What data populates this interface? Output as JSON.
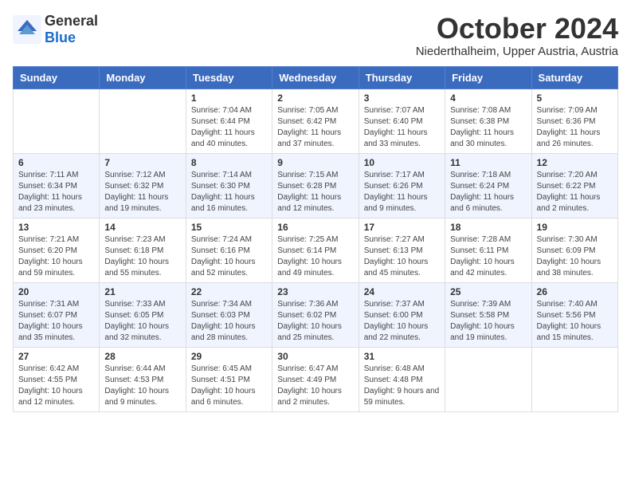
{
  "header": {
    "logo_general": "General",
    "logo_blue": "Blue",
    "month_title": "October 2024",
    "location": "Niederthalheim, Upper Austria, Austria"
  },
  "weekdays": [
    "Sunday",
    "Monday",
    "Tuesday",
    "Wednesday",
    "Thursday",
    "Friday",
    "Saturday"
  ],
  "weeks": [
    [
      {
        "day": "",
        "info": ""
      },
      {
        "day": "",
        "info": ""
      },
      {
        "day": "1",
        "info": "Sunrise: 7:04 AM\nSunset: 6:44 PM\nDaylight: 11 hours and 40 minutes."
      },
      {
        "day": "2",
        "info": "Sunrise: 7:05 AM\nSunset: 6:42 PM\nDaylight: 11 hours and 37 minutes."
      },
      {
        "day": "3",
        "info": "Sunrise: 7:07 AM\nSunset: 6:40 PM\nDaylight: 11 hours and 33 minutes."
      },
      {
        "day": "4",
        "info": "Sunrise: 7:08 AM\nSunset: 6:38 PM\nDaylight: 11 hours and 30 minutes."
      },
      {
        "day": "5",
        "info": "Sunrise: 7:09 AM\nSunset: 6:36 PM\nDaylight: 11 hours and 26 minutes."
      }
    ],
    [
      {
        "day": "6",
        "info": "Sunrise: 7:11 AM\nSunset: 6:34 PM\nDaylight: 11 hours and 23 minutes."
      },
      {
        "day": "7",
        "info": "Sunrise: 7:12 AM\nSunset: 6:32 PM\nDaylight: 11 hours and 19 minutes."
      },
      {
        "day": "8",
        "info": "Sunrise: 7:14 AM\nSunset: 6:30 PM\nDaylight: 11 hours and 16 minutes."
      },
      {
        "day": "9",
        "info": "Sunrise: 7:15 AM\nSunset: 6:28 PM\nDaylight: 11 hours and 12 minutes."
      },
      {
        "day": "10",
        "info": "Sunrise: 7:17 AM\nSunset: 6:26 PM\nDaylight: 11 hours and 9 minutes."
      },
      {
        "day": "11",
        "info": "Sunrise: 7:18 AM\nSunset: 6:24 PM\nDaylight: 11 hours and 6 minutes."
      },
      {
        "day": "12",
        "info": "Sunrise: 7:20 AM\nSunset: 6:22 PM\nDaylight: 11 hours and 2 minutes."
      }
    ],
    [
      {
        "day": "13",
        "info": "Sunrise: 7:21 AM\nSunset: 6:20 PM\nDaylight: 10 hours and 59 minutes."
      },
      {
        "day": "14",
        "info": "Sunrise: 7:23 AM\nSunset: 6:18 PM\nDaylight: 10 hours and 55 minutes."
      },
      {
        "day": "15",
        "info": "Sunrise: 7:24 AM\nSunset: 6:16 PM\nDaylight: 10 hours and 52 minutes."
      },
      {
        "day": "16",
        "info": "Sunrise: 7:25 AM\nSunset: 6:14 PM\nDaylight: 10 hours and 49 minutes."
      },
      {
        "day": "17",
        "info": "Sunrise: 7:27 AM\nSunset: 6:13 PM\nDaylight: 10 hours and 45 minutes."
      },
      {
        "day": "18",
        "info": "Sunrise: 7:28 AM\nSunset: 6:11 PM\nDaylight: 10 hours and 42 minutes."
      },
      {
        "day": "19",
        "info": "Sunrise: 7:30 AM\nSunset: 6:09 PM\nDaylight: 10 hours and 38 minutes."
      }
    ],
    [
      {
        "day": "20",
        "info": "Sunrise: 7:31 AM\nSunset: 6:07 PM\nDaylight: 10 hours and 35 minutes."
      },
      {
        "day": "21",
        "info": "Sunrise: 7:33 AM\nSunset: 6:05 PM\nDaylight: 10 hours and 32 minutes."
      },
      {
        "day": "22",
        "info": "Sunrise: 7:34 AM\nSunset: 6:03 PM\nDaylight: 10 hours and 28 minutes."
      },
      {
        "day": "23",
        "info": "Sunrise: 7:36 AM\nSunset: 6:02 PM\nDaylight: 10 hours and 25 minutes."
      },
      {
        "day": "24",
        "info": "Sunrise: 7:37 AM\nSunset: 6:00 PM\nDaylight: 10 hours and 22 minutes."
      },
      {
        "day": "25",
        "info": "Sunrise: 7:39 AM\nSunset: 5:58 PM\nDaylight: 10 hours and 19 minutes."
      },
      {
        "day": "26",
        "info": "Sunrise: 7:40 AM\nSunset: 5:56 PM\nDaylight: 10 hours and 15 minutes."
      }
    ],
    [
      {
        "day": "27",
        "info": "Sunrise: 6:42 AM\nSunset: 4:55 PM\nDaylight: 10 hours and 12 minutes."
      },
      {
        "day": "28",
        "info": "Sunrise: 6:44 AM\nSunset: 4:53 PM\nDaylight: 10 hours and 9 minutes."
      },
      {
        "day": "29",
        "info": "Sunrise: 6:45 AM\nSunset: 4:51 PM\nDaylight: 10 hours and 6 minutes."
      },
      {
        "day": "30",
        "info": "Sunrise: 6:47 AM\nSunset: 4:49 PM\nDaylight: 10 hours and 2 minutes."
      },
      {
        "day": "31",
        "info": "Sunrise: 6:48 AM\nSunset: 4:48 PM\nDaylight: 9 hours and 59 minutes."
      },
      {
        "day": "",
        "info": ""
      },
      {
        "day": "",
        "info": ""
      }
    ]
  ]
}
